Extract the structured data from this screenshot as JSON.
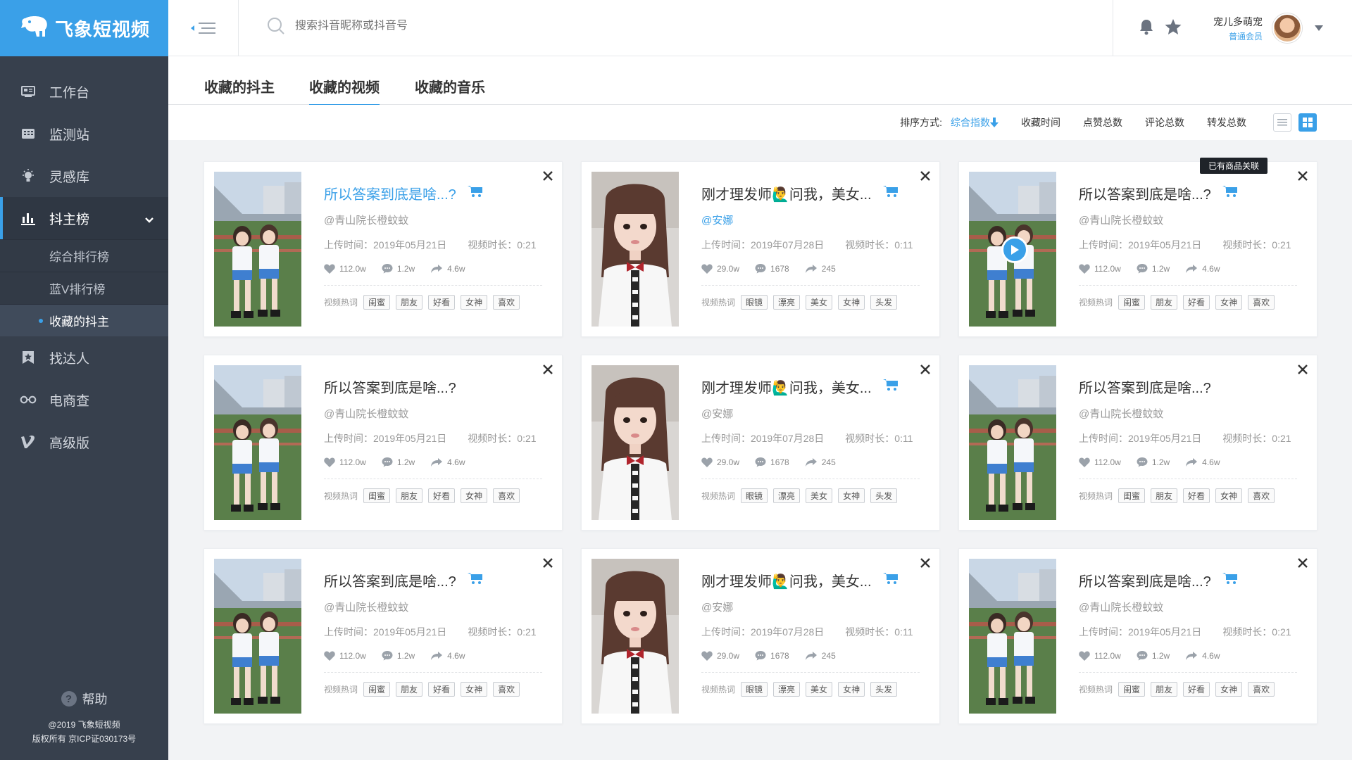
{
  "app": {
    "logo_text": "飞象短视频"
  },
  "search": {
    "placeholder": "搜索抖音昵称或抖音号"
  },
  "user": {
    "name": "宠儿多萌宠",
    "role": "普通会员"
  },
  "sidebar": {
    "items": [
      {
        "label": "工作台",
        "icon": "desk-icon"
      },
      {
        "label": "监测站",
        "icon": "monitor-icon"
      },
      {
        "label": "灵感库",
        "icon": "bulb-icon"
      },
      {
        "label": "抖主榜",
        "icon": "chart-icon"
      },
      {
        "label": "找达人",
        "icon": "bookmark-icon"
      },
      {
        "label": "电商查",
        "icon": "glasses-icon"
      },
      {
        "label": "高级版",
        "icon": "v-icon"
      }
    ],
    "sub_items": [
      {
        "label": "综合排行榜"
      },
      {
        "label": "蓝V排行榜"
      },
      {
        "label": "收藏的抖主"
      }
    ],
    "help": "帮助",
    "copyright": "@2019 飞象短视频",
    "icp": "版权所有 京ICP证030173号"
  },
  "tabs": [
    {
      "label": "收藏的抖主"
    },
    {
      "label": "收藏的视频"
    },
    {
      "label": "收藏的音乐"
    }
  ],
  "sort": {
    "label": "排序方式:",
    "options": [
      "综合指数",
      "收藏时间",
      "点赞总数",
      "评论总数",
      "转发总数"
    ]
  },
  "cards": [
    {
      "title": "所以答案到底是啥...?",
      "author": "@青山院长橙蚊蚊",
      "upload": "上传时间：2019年05月21日",
      "duration": "视频时长：0:21",
      "likes": "112.0w",
      "comments": "1.2w",
      "shares": "4.6w",
      "tags_label": "视频热词",
      "tags": [
        "闺蜜",
        "朋友",
        "好看",
        "女神",
        "喜欢"
      ],
      "cart": true,
      "highlight": true,
      "thumb": "girls"
    },
    {
      "title": "刚才理发师🙋‍♂️问我，美女...",
      "author": "@安娜",
      "upload": "上传时间：2019年07月28日",
      "duration": "视频时长：0:11",
      "likes": "29.0w",
      "comments": "1678",
      "shares": "245",
      "tags_label": "视频热词",
      "tags": [
        "眼镜",
        "漂亮",
        "美女",
        "女神",
        "头发"
      ],
      "cart": true,
      "author_hl": true,
      "thumb": "portrait"
    },
    {
      "title": "所以答案到底是啥...?",
      "author": "@青山院长橙蚊蚊",
      "upload": "上传时间：2019年05月21日",
      "duration": "视频时长：0:21",
      "likes": "112.0w",
      "comments": "1.2w",
      "shares": "4.6w",
      "tags_label": "视频热词",
      "tags": [
        "闺蜜",
        "朋友",
        "好看",
        "女神",
        "喜欢"
      ],
      "cart": true,
      "badge": "已有商品关联",
      "play": true,
      "thumb": "girls"
    },
    {
      "title": "所以答案到底是啥...?",
      "author": "@青山院长橙蚊蚊",
      "upload": "上传时间：2019年05月21日",
      "duration": "视频时长：0:21",
      "likes": "112.0w",
      "comments": "1.2w",
      "shares": "4.6w",
      "tags_label": "视频热词",
      "tags": [
        "闺蜜",
        "朋友",
        "好看",
        "女神",
        "喜欢"
      ],
      "thumb": "girls"
    },
    {
      "title": "刚才理发师🙋‍♂️问我，美女...",
      "author": "@安娜",
      "upload": "上传时间：2019年07月28日",
      "duration": "视频时长：0:11",
      "likes": "29.0w",
      "comments": "1678",
      "shares": "245",
      "tags_label": "视频热词",
      "tags": [
        "眼镜",
        "漂亮",
        "美女",
        "女神",
        "头发"
      ],
      "cart": true,
      "thumb": "portrait"
    },
    {
      "title": "所以答案到底是啥...?",
      "author": "@青山院长橙蚊蚊",
      "upload": "上传时间：2019年05月21日",
      "duration": "视频时长：0:21",
      "likes": "112.0w",
      "comments": "1.2w",
      "shares": "4.6w",
      "tags_label": "视频热词",
      "tags": [
        "闺蜜",
        "朋友",
        "好看",
        "女神",
        "喜欢"
      ],
      "thumb": "girls"
    },
    {
      "title": "所以答案到底是啥...?",
      "author": "@青山院长橙蚊蚊",
      "upload": "上传时间：2019年05月21日",
      "duration": "视频时长：0:21",
      "likes": "112.0w",
      "comments": "1.2w",
      "shares": "4.6w",
      "tags_label": "视频热词",
      "tags": [
        "闺蜜",
        "朋友",
        "好看",
        "女神",
        "喜欢"
      ],
      "cart": true,
      "thumb": "girls"
    },
    {
      "title": "刚才理发师🙋‍♂️问我，美女...",
      "author": "@安娜",
      "upload": "上传时间：2019年07月28日",
      "duration": "视频时长：0:11",
      "likes": "29.0w",
      "comments": "1678",
      "shares": "245",
      "tags_label": "视频热词",
      "tags": [
        "眼镜",
        "漂亮",
        "美女",
        "女神",
        "头发"
      ],
      "cart": true,
      "thumb": "portrait"
    },
    {
      "title": "所以答案到底是啥...?",
      "author": "@青山院长橙蚊蚊",
      "upload": "上传时间：2019年05月21日",
      "duration": "视频时长：0:21",
      "likes": "112.0w",
      "comments": "1.2w",
      "shares": "4.6w",
      "tags_label": "视频热词",
      "tags": [
        "闺蜜",
        "朋友",
        "好看",
        "女神",
        "喜欢"
      ],
      "cart": true,
      "thumb": "girls"
    }
  ],
  "colors": {
    "accent": "#3aa0e8",
    "sidebar": "#37404d"
  }
}
